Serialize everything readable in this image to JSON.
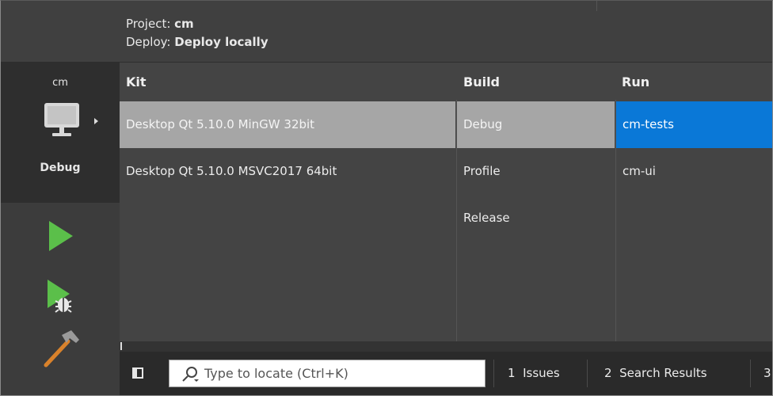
{
  "sidebar": {
    "project_name": "cm",
    "build_config": "Debug",
    "icons": [
      "monitor-icon",
      "play-icon",
      "debug-run-icon",
      "hammer-icon"
    ]
  },
  "header": {
    "project_label": "Project:",
    "project_value": "cm",
    "deploy_label": "Deploy:",
    "deploy_value": "Deploy locally"
  },
  "columns": {
    "kit": "Kit",
    "build": "Build",
    "run": "Run"
  },
  "kits": [
    "Desktop Qt 5.10.0 MinGW 32bit",
    "Desktop Qt 5.10.0 MSVC2017 64bit"
  ],
  "builds": [
    "Debug",
    "Profile",
    "Release"
  ],
  "runs": [
    "cm-tests",
    "cm-ui"
  ],
  "selected": {
    "kit": 0,
    "build": 0,
    "run": 0
  },
  "statusbar": {
    "locator_placeholder": "Type to locate (Ctrl+K)",
    "tabs": [
      {
        "num": "1",
        "label": "Issues"
      },
      {
        "num": "2",
        "label": "Search Results"
      },
      {
        "num": "3",
        "label": ""
      }
    ]
  },
  "colors": {
    "accent_blue": "#0a78d7",
    "selection_gray": "#a6a6a6",
    "run_green": "#5bbf4a"
  }
}
